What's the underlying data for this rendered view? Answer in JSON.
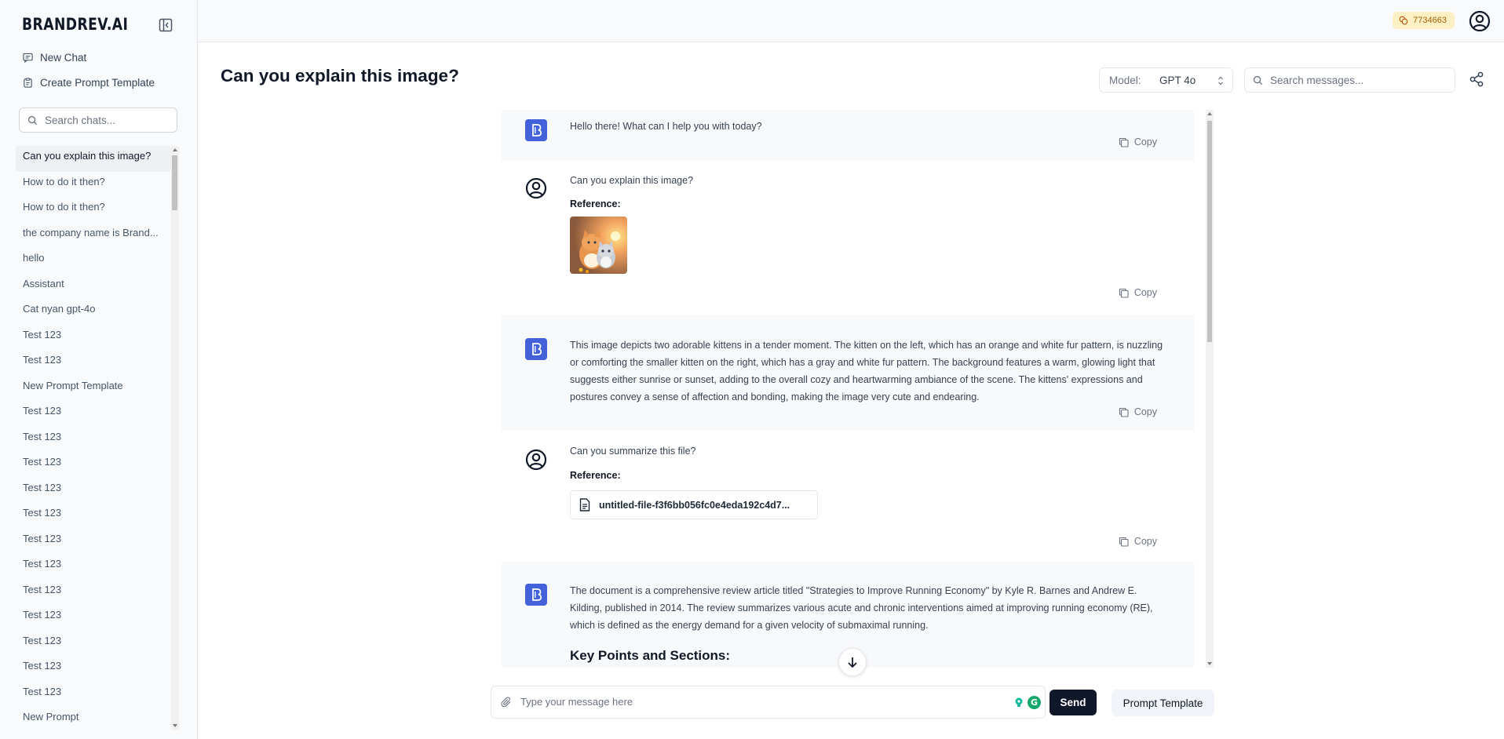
{
  "brand": "BRANDREV.AI",
  "sidebar": {
    "new_chat": "New Chat",
    "create_prompt_template": "Create Prompt Template",
    "search_placeholder": "Search chats...",
    "chats": [
      "Can you explain this image?",
      "How to do it then?",
      "How to do it then?",
      "the company name is Brand...",
      "hello",
      "Assistant",
      "Cat nyan gpt-4o",
      "Test 123",
      "Test 123",
      "New Prompt Template",
      "Test 123",
      "Test 123",
      "Test 123",
      "Test 123",
      "Test 123",
      "Test 123",
      "Test 123",
      "Test 123",
      "Test 123",
      "Test 123",
      "Test 123",
      "Test 123",
      "New Prompt"
    ]
  },
  "topbar": {
    "credits": "7734663"
  },
  "header": {
    "title": "Can you explain this image?",
    "model_label": "Model:",
    "model_value": "GPT 4o",
    "search_placeholder": "Search messages..."
  },
  "messages": [
    {
      "role": "assistant",
      "text": "Hello there! What can I help you with today?",
      "copy": "Copy"
    },
    {
      "role": "user",
      "text": "Can you explain this image?",
      "reference_label": "Reference:",
      "copy": "Copy"
    },
    {
      "role": "assistant",
      "text": "This image depicts two adorable kittens in a tender moment. The kitten on the left, which has an orange and white fur pattern, is nuzzling or comforting the smaller kitten on the right, which has a gray and white fur pattern. The background features a warm, glowing light that suggests either sunrise or sunset, adding to the overall cozy and heartwarming ambiance of the scene. The kittens' expressions and postures convey a sense of affection and bonding, making the image very cute and endearing.",
      "copy": "Copy"
    },
    {
      "role": "user",
      "text": "Can you summarize this file?",
      "reference_label": "Reference:",
      "file_name": "untitled-file-f3f6bb056fc0e4eda192c4d7...",
      "copy": "Copy"
    },
    {
      "role": "assistant",
      "text": "The document is a comprehensive review article titled \"Strategies to Improve Running Economy\" by Kyle R. Barnes and Andrew E. Kilding, published in 2014. The review summarizes various acute and chronic interventions aimed at improving running economy (RE), which is defined as the energy demand for a given velocity of submaximal running.",
      "section_heading": "Key Points and Sections:"
    }
  ],
  "composer": {
    "placeholder": "Type your message here",
    "send": "Send",
    "prompt_template": "Prompt Template",
    "extension_badge": "G"
  },
  "colors": {
    "brand_blue": "#4361d8",
    "send_bg": "#0f172a",
    "credits_bg": "#fdf0c5",
    "credits_text": "#a16207"
  }
}
